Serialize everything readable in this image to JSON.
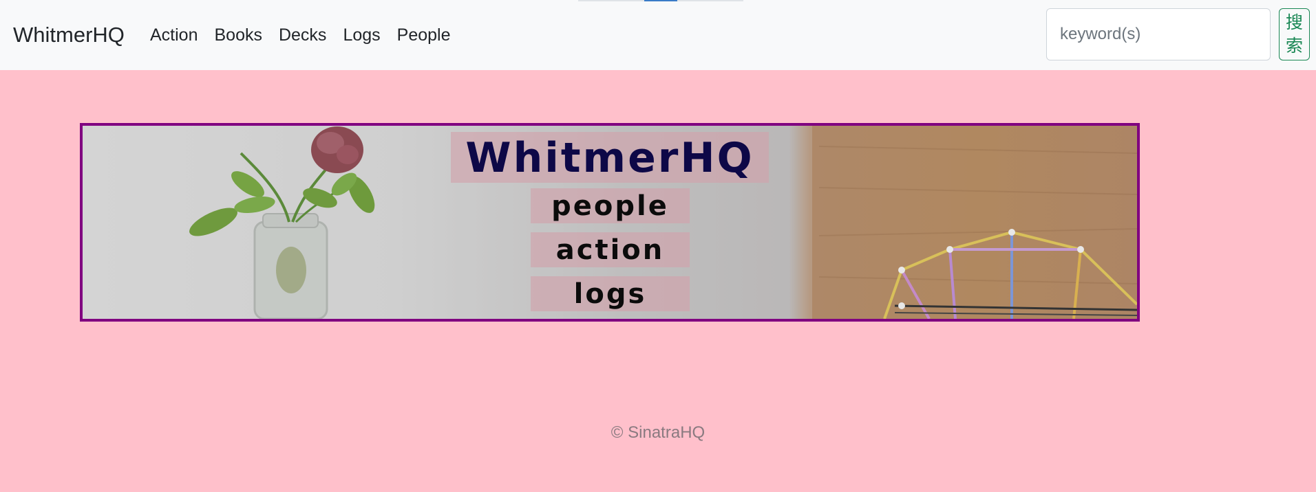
{
  "navbar": {
    "brand": "WhitmerHQ",
    "links": [
      "Action",
      "Books",
      "Decks",
      "Logs",
      "People"
    ],
    "search": {
      "placeholder": "keyword(s)",
      "value": "",
      "button_label": "搜索"
    }
  },
  "banner": {
    "title": "WhitmerHQ",
    "links": [
      "people",
      "action",
      "logs"
    ]
  },
  "footer": {
    "text": "© SinatraHQ"
  },
  "colors": {
    "page_background": "#ffc0cb",
    "navbar_background": "#f8f9fa",
    "banner_border": "#800080",
    "search_button": "#198754",
    "banner_title_text": "#0d0847"
  }
}
